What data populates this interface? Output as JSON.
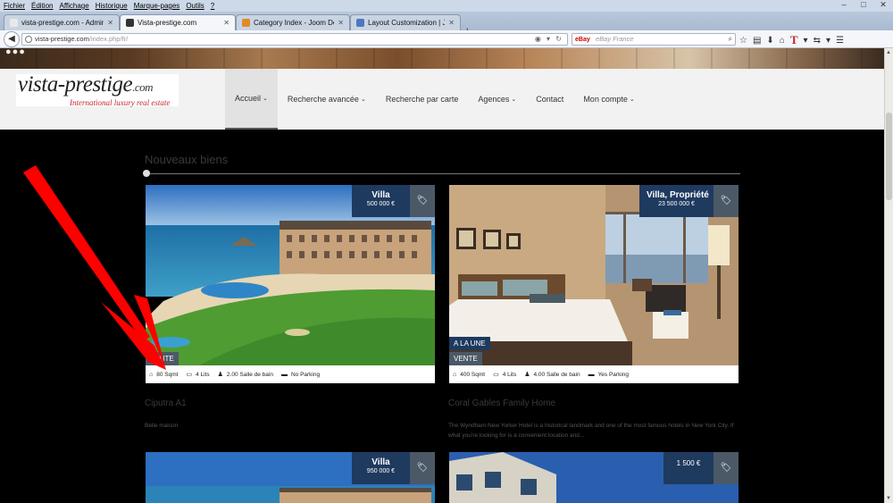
{
  "browser": {
    "menu": [
      "Fichier",
      "Édition",
      "Affichage",
      "Historique",
      "Marque-pages",
      "Outils",
      "?"
    ],
    "tabs": [
      {
        "label": "vista-prestige.com - Administr...",
        "favicon": "#e8e8e8"
      },
      {
        "label": "Vista-prestige.com",
        "favicon": "#333333"
      },
      {
        "label": "Category Index - Joom Do...",
        "favicon": "#e08a2a"
      },
      {
        "label": "Layout Customization | Jo...",
        "favicon": "#4a78c4"
      }
    ],
    "new_tab": "+",
    "url": "vista-prestige.com",
    "url_path": "/index.php/fr/",
    "search_engine": "eBay",
    "search_placeholder": "eBay France",
    "window_controls": [
      "–",
      "□",
      "✕"
    ]
  },
  "site": {
    "logo_main": "vista-prestige",
    "logo_tld": ".com",
    "logo_tagline": "International luxury real estate",
    "nav": [
      {
        "label": "Accueil",
        "caret": "⌄"
      },
      {
        "label": "Recherche avancée",
        "caret": "⌄"
      },
      {
        "label": "Recherche par carte",
        "caret": ""
      },
      {
        "label": "Agences",
        "caret": "⌄"
      },
      {
        "label": "Contact",
        "caret": ""
      },
      {
        "label": "Mon compte",
        "caret": "⌄"
      }
    ],
    "section_title": "Nouveaux biens"
  },
  "listings": [
    {
      "type": "Villa",
      "price": "500 000 €",
      "badge_top": "",
      "badge_bottom": "VENTE",
      "area": "80 Sqmt",
      "beds": "4 Lits",
      "baths": "2.00 Salle de bain",
      "parking": "No Parking",
      "title": "Ciputra A1",
      "desc": "Belle maison"
    },
    {
      "type": "Villa, Propriété",
      "price": "23 500 000 €",
      "badge_top": "A LA UNE",
      "badge_bottom": "VENTE",
      "area": "400 Sqmt",
      "beds": "4 Lits",
      "baths": "4.00 Salle de bain",
      "parking": "Yes Parking",
      "title": "Coral Gables Family Home",
      "desc": "The Wyndham New Yorker Hotel is a historical landmark and one of the most famous hotels in New York City. If what you're looking for is a convenient location and..."
    },
    {
      "type": "Villa",
      "price": "950 000 €"
    },
    {
      "type": "",
      "price": "1 500 €"
    }
  ],
  "colors": {
    "accent": "#1f3a5f",
    "tag": "#4b5966",
    "arrow": "#ff0000"
  }
}
